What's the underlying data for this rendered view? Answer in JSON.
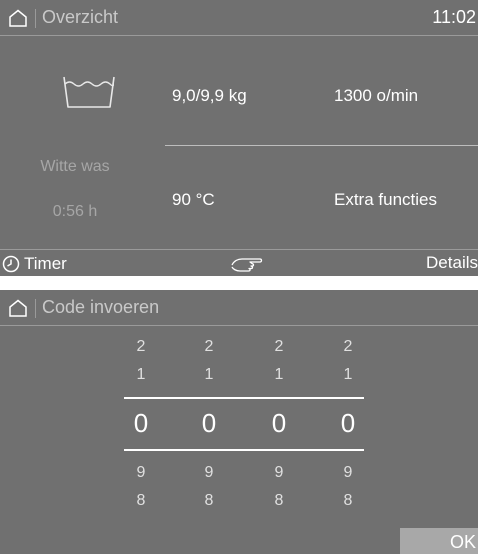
{
  "overview": {
    "title": "Overzicht",
    "clock": "11:02",
    "program": "Witte was",
    "duration": "0:56  h",
    "load": "9,0/9,9 kg",
    "spin": "1300 o/min",
    "temperature": "90 °C",
    "extra": "Extra functies",
    "footer": {
      "timer_label": "Timer",
      "details_label": "Details"
    },
    "icons": {
      "home": "home-icon",
      "tub": "wash-tub-icon",
      "clock": "clock-icon",
      "hand": "pointing-hand-icon"
    }
  },
  "code_entry": {
    "title": "Code invoeren",
    "columns": [
      {
        "above2": "2",
        "above1": "1",
        "current": "0",
        "below1": "9",
        "below2": "8"
      },
      {
        "above2": "2",
        "above1": "1",
        "current": "0",
        "below1": "9",
        "below2": "8"
      },
      {
        "above2": "2",
        "above1": "1",
        "current": "0",
        "below1": "9",
        "below2": "8"
      },
      {
        "above2": "2",
        "above1": "1",
        "current": "0",
        "below1": "9",
        "below2": "8"
      }
    ],
    "ok_label": "OK"
  }
}
